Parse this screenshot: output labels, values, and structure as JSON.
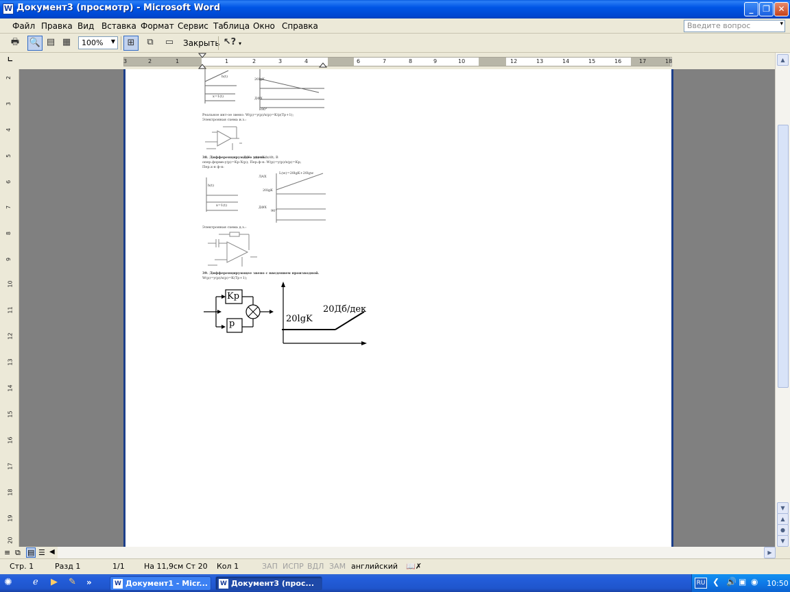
{
  "window": {
    "title": "Документ3 (просмотр) - Microsoft Word",
    "icon": "word-icon"
  },
  "menu": {
    "items": [
      "Файл",
      "Правка",
      "Вид",
      "Вставка",
      "Формат",
      "Сервис",
      "Таблица",
      "Окно",
      "Справка"
    ],
    "ask_placeholder": "Введите вопрос"
  },
  "toolbar": {
    "zoom": "100%",
    "close_label": "Закрыть"
  },
  "ruler": {
    "h_labels": [
      "3",
      "2",
      "1",
      "1",
      "2",
      "3",
      "4",
      "6",
      "7",
      "8",
      "9",
      "10",
      "12",
      "13",
      "14",
      "15",
      "16",
      "17",
      "18"
    ],
    "v_labels": [
      "2",
      "3",
      "4",
      "5",
      "6",
      "7",
      "8",
      "9",
      "10",
      "11",
      "12",
      "13",
      "14",
      "15",
      "16",
      "17",
      "18",
      "19",
      "20"
    ]
  },
  "document": {
    "fig1_h": "h(t)",
    "fig1_x": "x=1(t)",
    "fig1_lax": "20lgK",
    "fig1_dfx": "ДФХ",
    "fig1_deg": "-90°",
    "line1": "Реальное инт-ое звено: W(p)=y(p)/x(p)=K/p(Tp+1);",
    "line2": "Электронная схема и.з.:",
    "heading38": "38. Дифференцирующее звено.",
    "line38a": "Д.У.: y(t)=Kdx/dt; В",
    "line38b": "опер.форме:y(p)=Kp·X(p); Пер.ф-я: W(p)=y(p)/x(p)=Kp;",
    "line38c": "Пер.х-я ф-я:",
    "fig2_h": "h(t)",
    "fig2_x": "x=1(t)",
    "fig2_lax": "ЛАХ",
    "fig2_formula": "L(w)=20lgK+20lgw",
    "fig2_20lgk": "20lgK",
    "fig2_dfx": "ДФХ",
    "fig2_deg": "90°",
    "line_scheme": "Электронная схема д.з.:",
    "heading39": "39. Дифференцирующее звено с введением производной.",
    "line39": "W(p)=y(p)/x(p)=K(Tp+1);",
    "block_kp": "Kp",
    "block_p": "p",
    "graph_20lgk": "20lgK",
    "graph_slope": "20Дб/дек"
  },
  "status": {
    "page": "Стр. 1",
    "section": "Разд 1",
    "pages": "1/1",
    "at": "На 11,9см",
    "line": "Ст 20",
    "col": "Кол 1",
    "rec": "ЗАП",
    "trk": "ИСПР",
    "ext": "ВДЛ",
    "ovr": "ЗАМ",
    "language": "английский"
  },
  "taskbar": {
    "tasks": [
      "Документ1 - Micr...",
      "Документ3 (прос..."
    ],
    "lang": "RU",
    "clock": "10:50"
  }
}
